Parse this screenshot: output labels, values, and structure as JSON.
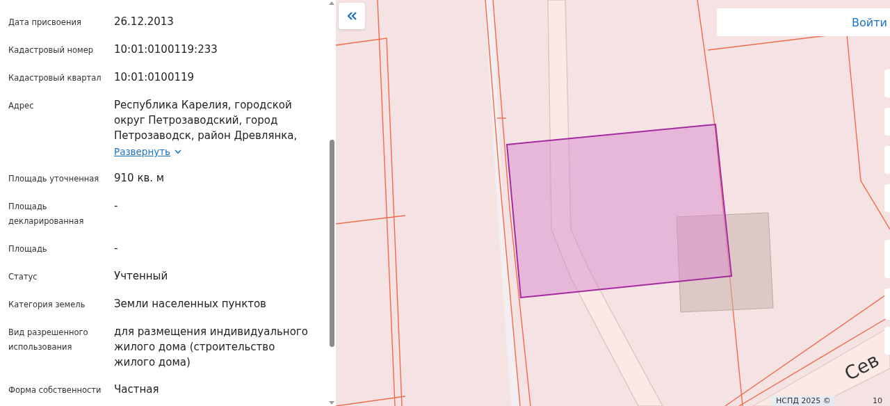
{
  "details": [
    {
      "label": "Дата присвоения",
      "value": "26.12.2013"
    },
    {
      "label": "Кадастровый номер",
      "value": "10:01:0100119:233"
    },
    {
      "label": "Кадастровый квартал",
      "value": "10:01:0100119"
    },
    {
      "label": "Адрес",
      "value": "Республика Карелия, городской округ Петрозаводский, город Петрозаводск, район Древлянка,",
      "expand_link": "Развернуть"
    },
    {
      "label": "Площадь уточненная",
      "value": "910 кв. м"
    },
    {
      "label": "Площадь декларированная",
      "value": "-"
    },
    {
      "label": "Площадь",
      "value": "-"
    },
    {
      "label": "Статус",
      "value": "Учтенный"
    },
    {
      "label": "Категория земель",
      "value": "Земли населенных пунктов"
    },
    {
      "label": "Вид разрешенного использования",
      "value": "для размещения индивидуального жилого дома (строительство жилого дома)"
    },
    {
      "label": "Форма собственности",
      "value": "Частная"
    }
  ],
  "map": {
    "login_button": "Войти",
    "street_label": "Сев",
    "attribution": "НСПД 2025 ©",
    "scale_label": "10"
  }
}
